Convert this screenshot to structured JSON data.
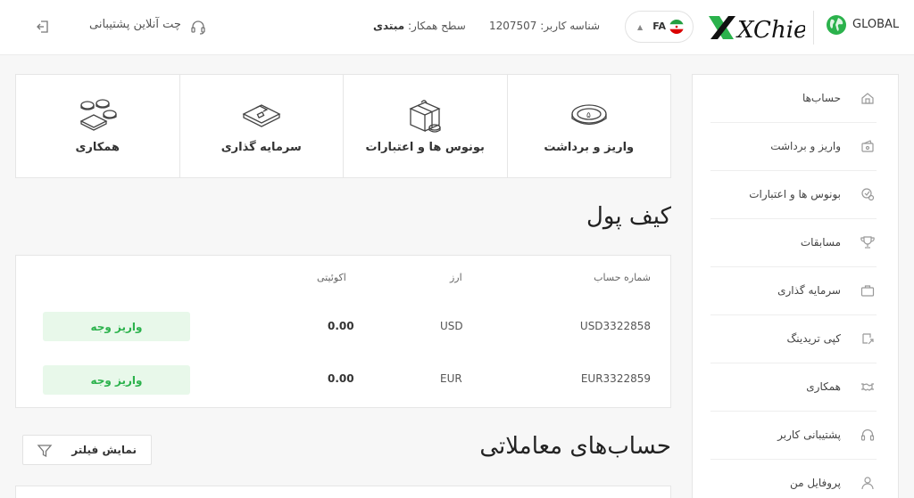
{
  "header": {
    "global_label": "GLOBAL",
    "logo_text": "XChief",
    "language_code": "FA",
    "user_id_text": "شناسه کاربر: 1207507",
    "partner_level_label": "سطح همکار:",
    "partner_level_value": "مبتدی",
    "support_chat_label": "چت آنلاین پشتیبانی"
  },
  "quick_cards": [
    {
      "label": "واریز و برداشت",
      "icon": "coin-icon"
    },
    {
      "label": "بونوس ها و اعتبارات",
      "icon": "gift-box-icon"
    },
    {
      "label": "سرمایه گذاری",
      "icon": "briefcase-icon"
    },
    {
      "label": "همکاری",
      "icon": "partners-icon"
    }
  ],
  "wallet": {
    "title": "کیف پول",
    "columns": {
      "account_number": "شماره حساب",
      "currency": "ارز",
      "equity": "اکوئیتی"
    },
    "rows": [
      {
        "account_number": "USD3322858",
        "currency": "USD",
        "equity": "0.00",
        "action": "واریز وجه"
      },
      {
        "account_number": "EUR3322859",
        "currency": "EUR",
        "equity": "0.00",
        "action": "واریز وجه"
      }
    ]
  },
  "trading_accounts": {
    "title": "حساب‌های معاملاتی",
    "filter_label": "نمایش فیلتر"
  },
  "sidebar": {
    "items": [
      {
        "label": "حساب‌ها",
        "icon": "home-icon"
      },
      {
        "label": "واریز و برداشت",
        "icon": "wallet-icon"
      },
      {
        "label": "بونوس ها و اعتبارات",
        "icon": "bonus-icon"
      },
      {
        "label": "مسابقات",
        "icon": "trophy-icon"
      },
      {
        "label": "سرمایه گذاری",
        "icon": "briefcase-icon"
      },
      {
        "label": "کپی تریدینگ",
        "icon": "copy-trading-icon"
      },
      {
        "label": "همکاری",
        "icon": "handshake-icon"
      },
      {
        "label": "پشتیبانی کاربر",
        "icon": "headset-icon"
      },
      {
        "label": "پروفایل من",
        "icon": "user-icon"
      }
    ]
  },
  "colors": {
    "accent_green": "#2bb24c",
    "button_bg": "#e8f8ea",
    "page_bg": "#f7f7f7"
  }
}
